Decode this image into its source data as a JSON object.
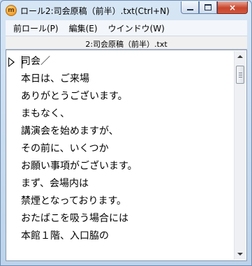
{
  "window": {
    "title": "ロール2:司会原稿（前半）.txt(Ctrl+N)",
    "app_icon_glyph": "m",
    "buttons": {
      "minimize": "minimize-icon",
      "maximize": "maximize-icon",
      "close": "×"
    }
  },
  "menu": {
    "items": [
      {
        "label": "前ロール(P)"
      },
      {
        "label": "編集(E)"
      },
      {
        "label": "ウインドウ(W)"
      }
    ]
  },
  "document": {
    "name": "2:司会原稿（前半）.txt"
  },
  "editor": {
    "lines": [
      "司会／",
      "本日は、ご来場",
      "ありがとうございます。",
      "まもなく、",
      "講演会を始めますが、",
      "その前に、いくつか",
      "お願い事項がございます。",
      "まず、会場内は",
      "禁煙となっております。",
      "おたばこを吸う場合には",
      "本館１階、入口脇の"
    ]
  },
  "colors": {
    "frame": "#c9dcef",
    "close_button": "#c8452c",
    "editor_bg": "#ffffff"
  }
}
